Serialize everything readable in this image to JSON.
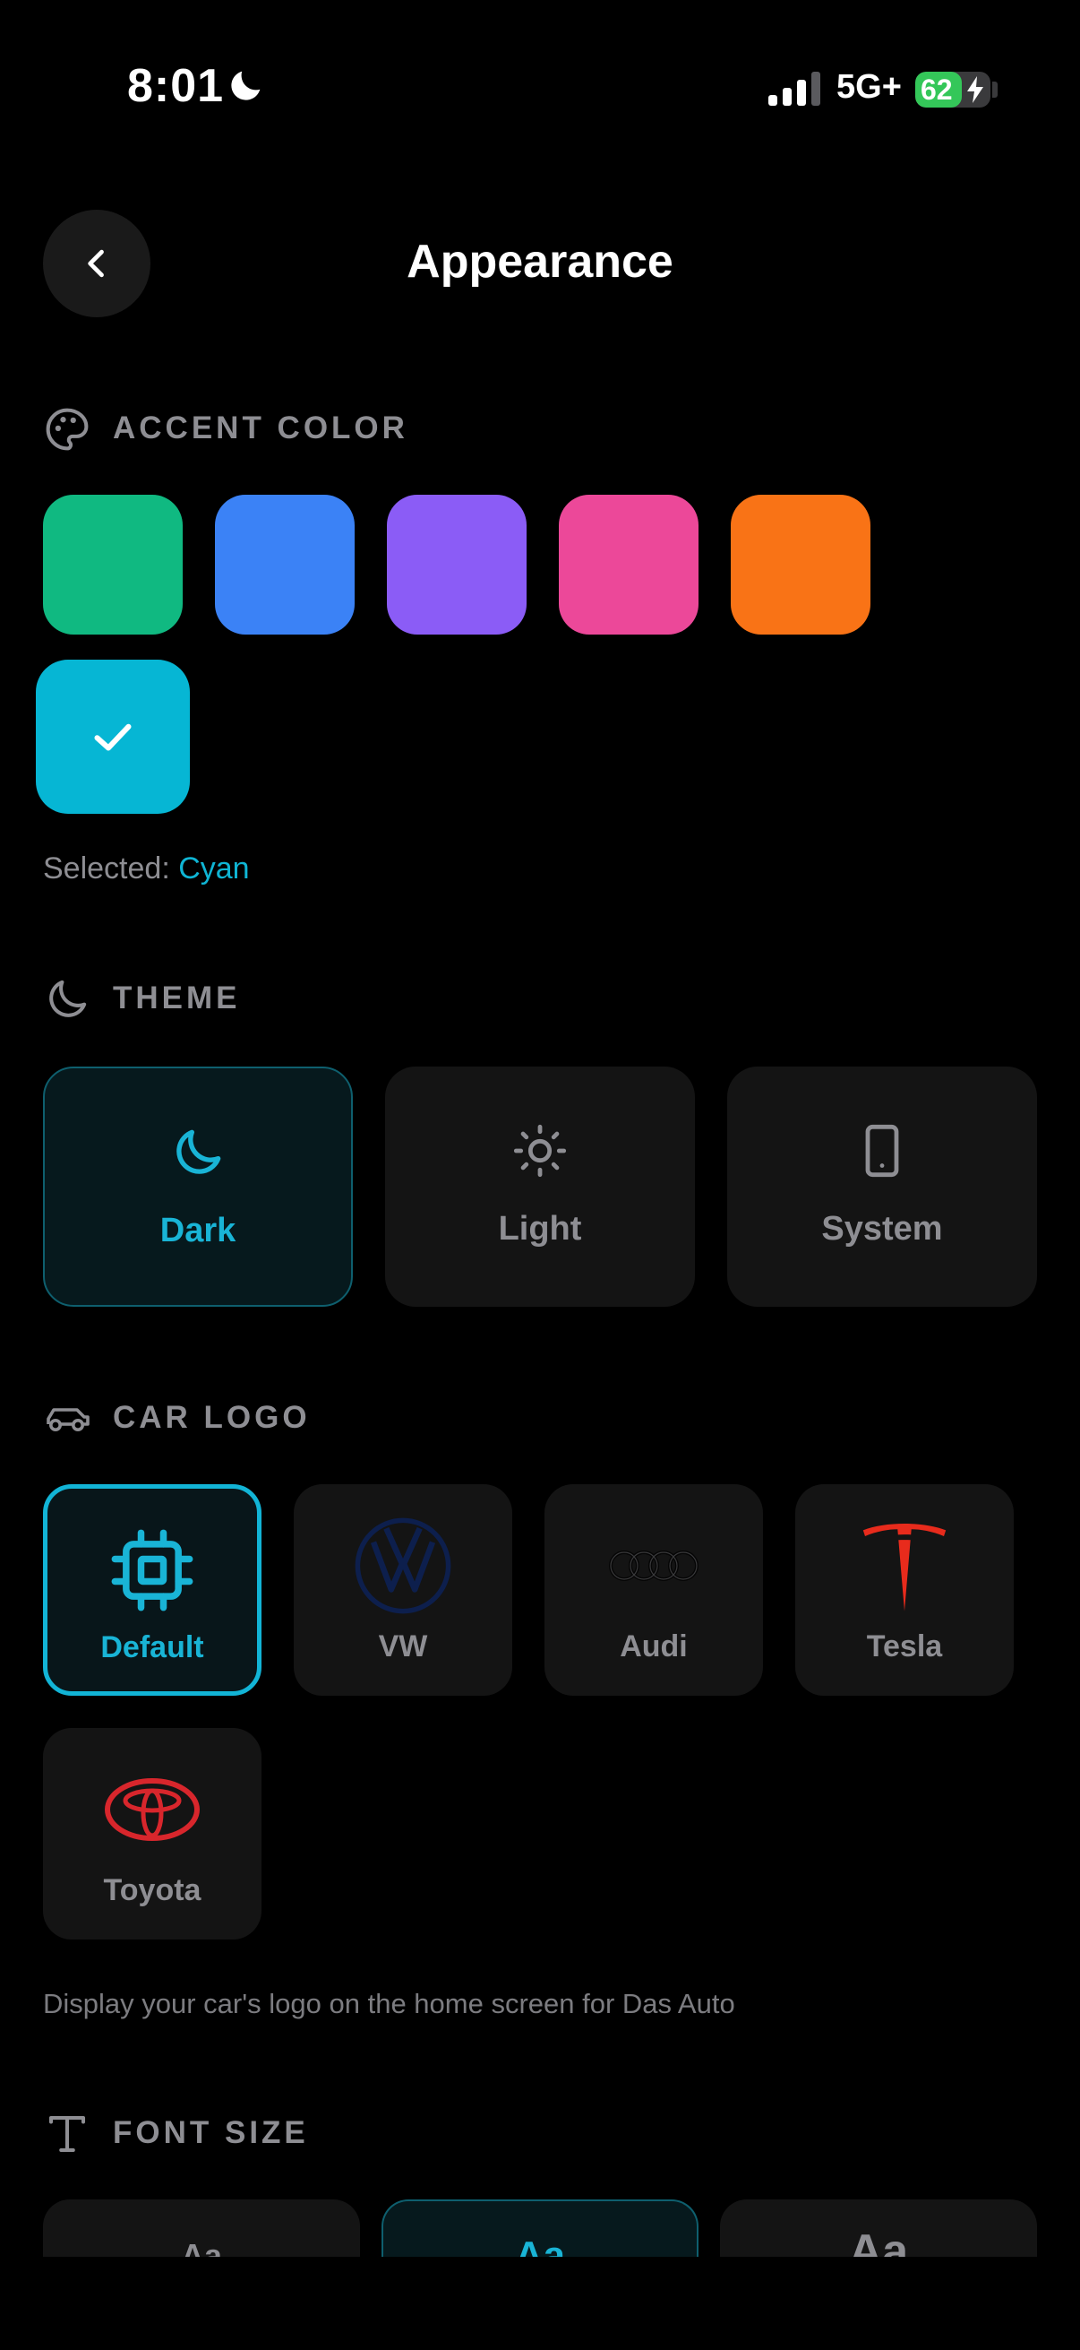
{
  "status_bar": {
    "time": "8:01",
    "network": "5G+",
    "battery": "62",
    "battery_level": 0.62,
    "icons": [
      "moon-icon",
      "signal-icon",
      "battery-icon",
      "bolt-icon"
    ]
  },
  "header": {
    "title": "Appearance",
    "back_icon": "chevron-left-icon"
  },
  "accent": {
    "label": "ACCENT COLOR",
    "icon": "palette-icon",
    "colors": [
      {
        "name": "green",
        "hex": "#10b981"
      },
      {
        "name": "blue",
        "hex": "#3b82f6"
      },
      {
        "name": "purple",
        "hex": "#8b5cf6"
      },
      {
        "name": "pink",
        "hex": "#ec4899"
      },
      {
        "name": "orange",
        "hex": "#f97316"
      },
      {
        "name": "cyan",
        "hex": "#06b6d4",
        "selected": true
      }
    ],
    "selected_prefix": "Selected:",
    "selected_value": "Cyan"
  },
  "theme": {
    "label": "THEME",
    "icon": "moon-icon",
    "options": [
      {
        "label": "Dark",
        "icon": "moon-icon",
        "selected": true
      },
      {
        "label": "Light",
        "icon": "sun-icon"
      },
      {
        "label": "System",
        "icon": "phone-icon"
      }
    ]
  },
  "car_logo": {
    "label": "CAR LOGO",
    "icon": "car-icon",
    "options": [
      {
        "label": "Default",
        "icon": "chip-icon",
        "selected": true
      },
      {
        "label": "VW",
        "icon": "vw-logo"
      },
      {
        "label": "Audi",
        "icon": "audi-logo"
      },
      {
        "label": "Tesla",
        "icon": "tesla-logo"
      },
      {
        "label": "Toyota",
        "icon": "toyota-logo"
      }
    ],
    "description": "Display your car's logo on the home screen for Das Auto"
  },
  "font_size": {
    "label": "FONT SIZE",
    "icon": "text-icon",
    "options": [
      {
        "label": "Aa"
      },
      {
        "label": "Aa",
        "selected": true
      },
      {
        "label": "Aa"
      }
    ]
  },
  "colors": {
    "accent": "#06b6d4",
    "background": "#000000",
    "card": "#141414",
    "muted": "#8e8e93"
  }
}
